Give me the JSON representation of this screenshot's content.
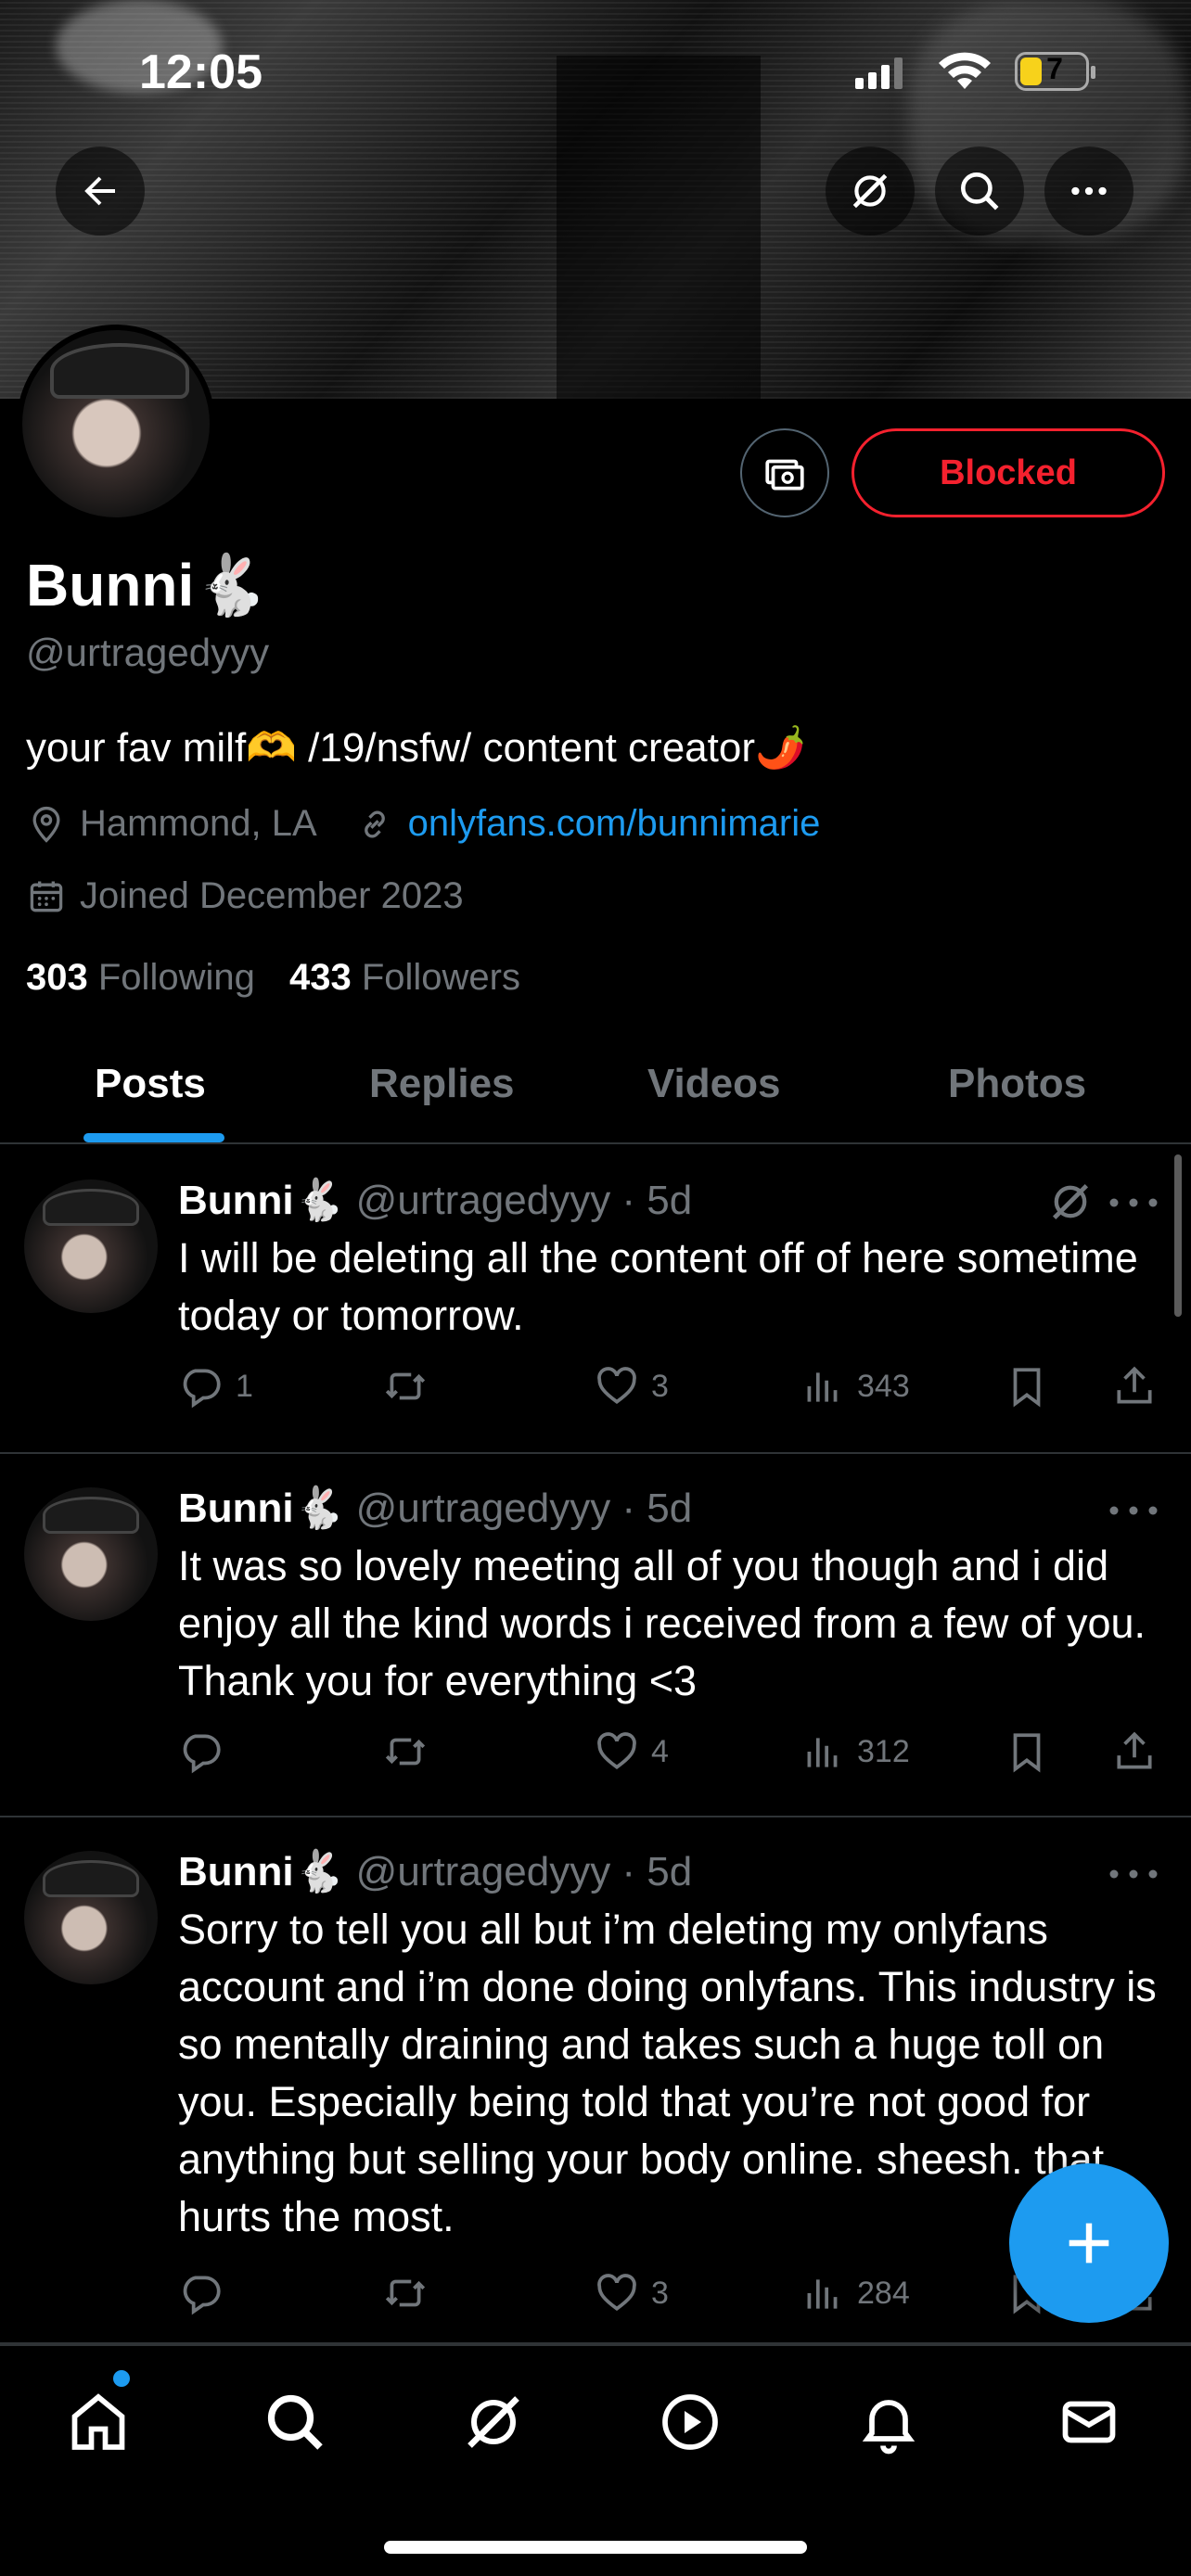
{
  "status_bar": {
    "time": "12:05",
    "battery": "7"
  },
  "profile": {
    "name": "Bunni🐇",
    "handle": "@urtragedyyy",
    "bio": "your fav milf🫶 /19/nsfw/ content creator🌶️",
    "location": "Hammond, LA",
    "website": "onlyfans.com/bunnimarie",
    "joined": "Joined December 2023",
    "following_count": "303",
    "following_label": "Following",
    "followers_count": "433",
    "followers_label": "Followers",
    "blocked_label": "Blocked"
  },
  "tabs": [
    {
      "label": "Posts",
      "active": true
    },
    {
      "label": "Replies"
    },
    {
      "label": "Videos"
    },
    {
      "label": "Photos"
    }
  ],
  "posts": [
    {
      "name": "Bunni🐇",
      "meta": "@urtragedyyy · 5d",
      "text": "I will be deleting all the content off of here sometime today or tomorrow.",
      "replies": "1",
      "reposts": "",
      "likes": "3",
      "views": "343"
    },
    {
      "name": "Bunni🐇",
      "meta": "@urtragedyyy · 5d",
      "text": "It was so lovely meeting all of you though and i did enjoy all the kind words i received from a few of you. Thank you for everything <3",
      "replies": "",
      "reposts": "",
      "likes": "4",
      "views": "312"
    },
    {
      "name": "Bunni🐇",
      "meta": "@urtragedyyy · 5d",
      "text": "Sorry to tell you all but i’m deleting my onlyfans account and i’m done doing onlyfans. This industry is so mentally draining and takes such a huge toll on you. Especially being told that you’re not good for anything but selling your body online. sheesh. that hurts the most.",
      "replies": "",
      "reposts": "",
      "likes": "3",
      "views": "284"
    }
  ],
  "colors": {
    "accent": "#1d9bf0",
    "blocked": "#f4212e",
    "muted": "#71767b",
    "background": "#000000"
  },
  "icons": [
    "back-arrow-icon",
    "grok-icon",
    "search-icon",
    "more-icon",
    "money-icon",
    "location-icon",
    "link-icon",
    "calendar-icon",
    "reply-icon",
    "repost-icon",
    "like-icon",
    "views-icon",
    "bookmark-icon",
    "share-icon",
    "plus-icon",
    "home-icon",
    "notifications-icon",
    "messages-icon",
    "video-icon"
  ]
}
